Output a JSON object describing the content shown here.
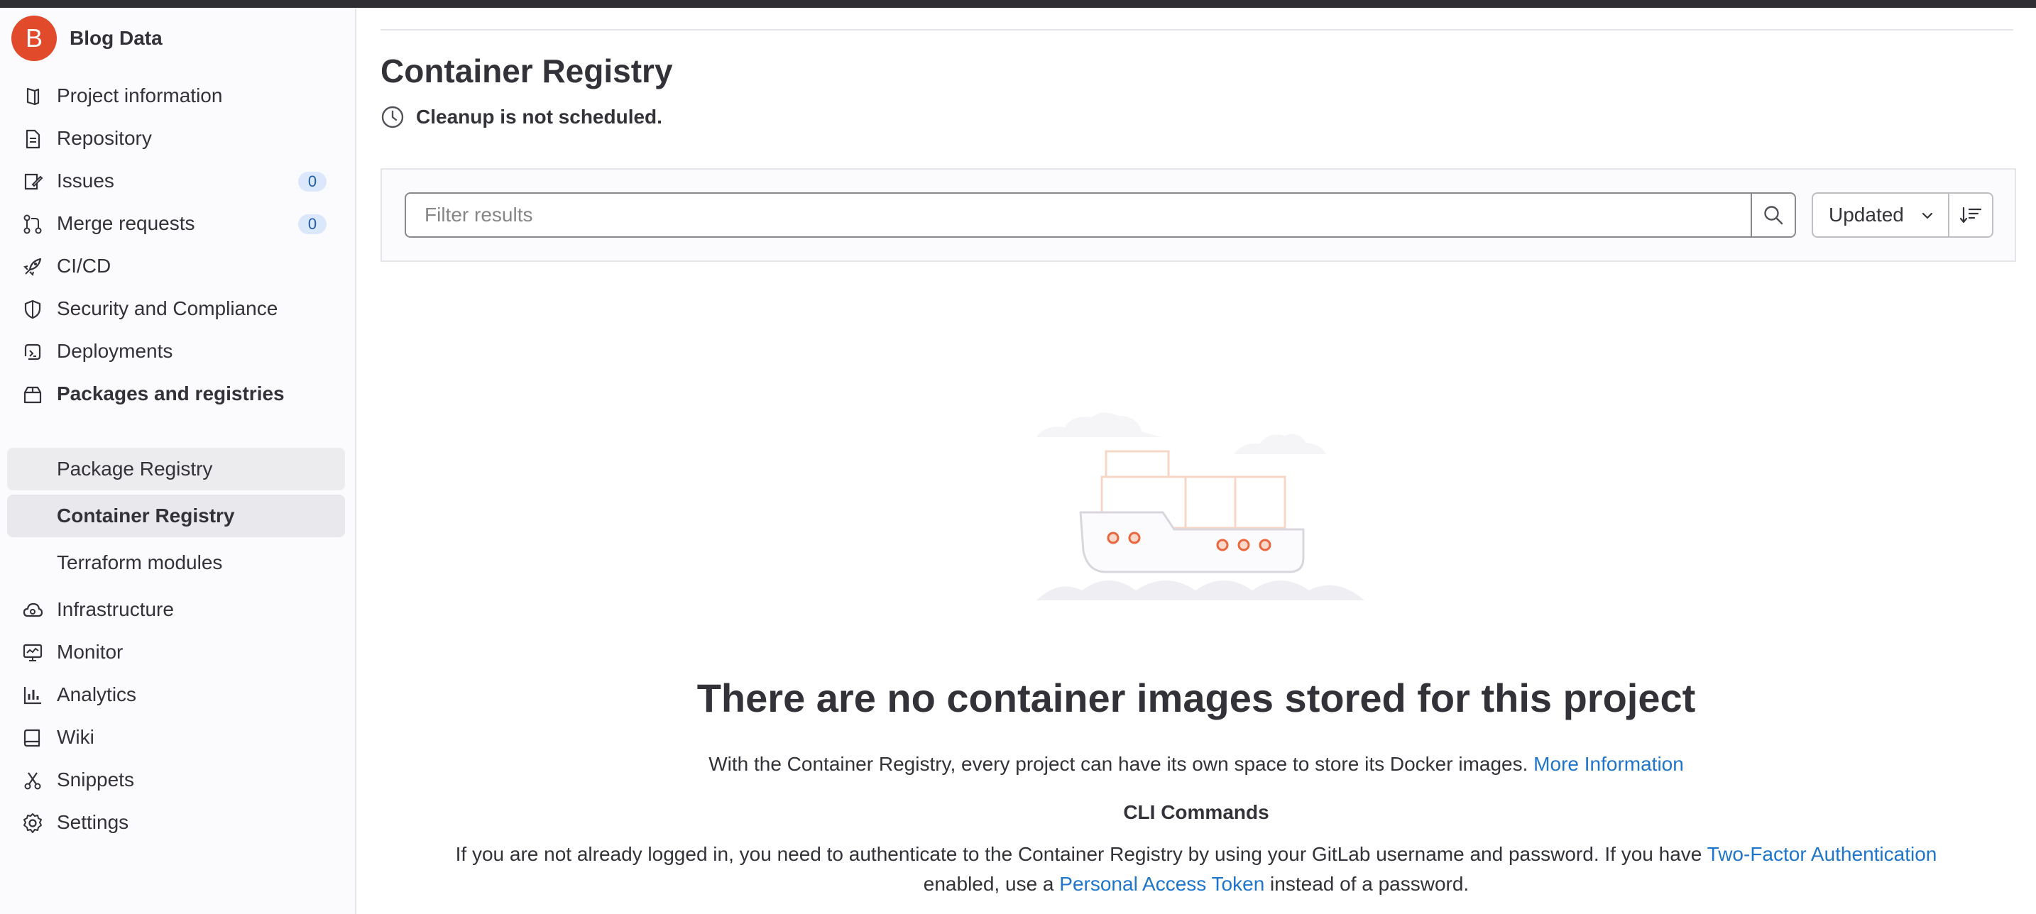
{
  "project": {
    "avatar_letter": "B",
    "name": "Blog Data"
  },
  "sidebar": {
    "items": [
      {
        "label": "Project information",
        "icon": "project-info-icon"
      },
      {
        "label": "Repository",
        "icon": "repository-icon"
      },
      {
        "label": "Issues",
        "icon": "issues-icon",
        "count": "0"
      },
      {
        "label": "Merge requests",
        "icon": "merge-request-icon",
        "count": "0"
      },
      {
        "label": "CI/CD",
        "icon": "rocket-icon"
      },
      {
        "label": "Security and Compliance",
        "icon": "shield-icon"
      },
      {
        "label": "Deployments",
        "icon": "deployments-icon"
      },
      {
        "label": "Packages and registries",
        "icon": "package-icon"
      },
      {
        "label": "Package Registry"
      },
      {
        "label": "Container Registry"
      },
      {
        "label": "Terraform modules"
      },
      {
        "label": "Infrastructure",
        "icon": "cloud-gear-icon"
      },
      {
        "label": "Monitor",
        "icon": "monitor-icon"
      },
      {
        "label": "Analytics",
        "icon": "chart-icon"
      },
      {
        "label": "Wiki",
        "icon": "book-icon"
      },
      {
        "label": "Snippets",
        "icon": "scissors-icon"
      },
      {
        "label": "Settings",
        "icon": "gear-icon"
      }
    ]
  },
  "main": {
    "title": "Container Registry",
    "cleanup_status": "Cleanup is not scheduled.",
    "filter": {
      "placeholder": "Filter results",
      "sort_label": "Updated"
    },
    "empty_state": {
      "title": "There are no container images stored for this project",
      "description": "With the Container Registry, every project can have its own space to store its Docker images.",
      "more_info_link": "More Information",
      "cli_title": "CLI Commands",
      "cli_text_1": "If you are not already logged in, you need to authenticate to the Container Registry by using your GitLab username and password. If you have",
      "two_factor_link": "Two-Factor Authentication",
      "cli_text_2": "enabled, use a",
      "pat_link": "Personal Access Token",
      "cli_text_3": "instead of a password."
    }
  },
  "colors": {
    "accent": "#1f75cb",
    "avatar": "#e24a2c",
    "topbar": "#2e2e33"
  }
}
